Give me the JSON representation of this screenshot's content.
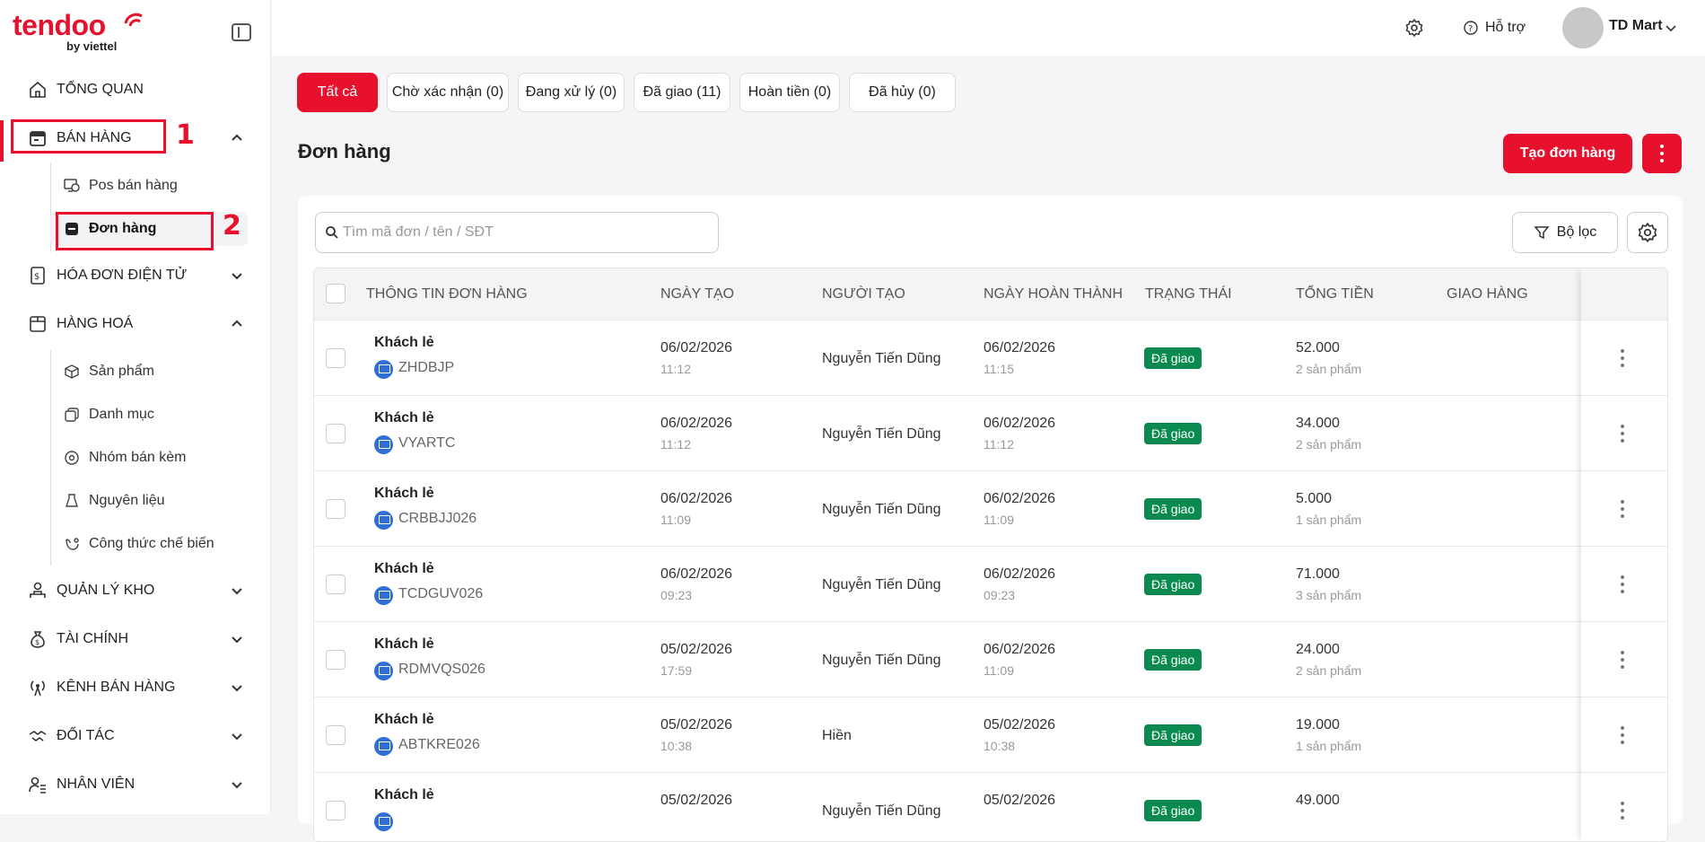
{
  "app": {
    "logo": "tendoo",
    "logo_sub": "by viettel"
  },
  "sidebar": {
    "items": [
      {
        "label": "TỔNG QUAN",
        "icon": "home-icon"
      },
      {
        "label": "BÁN HÀNG",
        "icon": "store-icon"
      },
      {
        "label": "HÓA ĐƠN ĐIỆN TỬ",
        "icon": "invoice-icon"
      },
      {
        "label": "HÀNG HOÁ",
        "icon": "box-icon"
      },
      {
        "label": "QUẢN LÝ KHO",
        "icon": "warehouse-icon"
      },
      {
        "label": "TÀI CHÍNH",
        "icon": "money-bag-icon"
      },
      {
        "label": "KÊNH BÁN HÀNG",
        "icon": "broadcast-icon"
      },
      {
        "label": "ĐỐI TÁC",
        "icon": "handshake-icon"
      },
      {
        "label": "NHÂN VIÊN",
        "icon": "staff-icon"
      }
    ],
    "sales_sub": [
      {
        "label": "Pos bán hàng",
        "icon": "pos-icon"
      },
      {
        "label": "Đơn hàng",
        "icon": "order-icon"
      }
    ],
    "goods_sub": [
      {
        "label": "Sản phẩm",
        "icon": "cube-icon"
      },
      {
        "label": "Danh mục",
        "icon": "category-icon"
      },
      {
        "label": "Nhóm bán kèm",
        "icon": "bundle-icon"
      },
      {
        "label": "Nguyên liệu",
        "icon": "ingredient-icon"
      },
      {
        "label": "Công thức chế biến",
        "icon": "recipe-icon"
      }
    ],
    "annotations": [
      "1",
      "2"
    ]
  },
  "header": {
    "support": "Hỗ trợ",
    "user": "TD Mart"
  },
  "tabs": [
    "Tất cả",
    "Chờ xác nhận (0)",
    "Đang xử lý (0)",
    "Đã giao (11)",
    "Hoàn tiền (0)",
    "Đã hủy (0)"
  ],
  "page": {
    "title": "Đơn hàng",
    "create_button": "Tạo đơn hàng"
  },
  "search": {
    "placeholder": "Tìm mã đơn / tên / SĐT"
  },
  "filter": {
    "label": "Bộ lọc"
  },
  "table": {
    "columns": [
      "THÔNG TIN ĐƠN HÀNG",
      "NGÀY TẠO",
      "NGƯỜI TẠO",
      "NGÀY HOÀN THÀNH",
      "TRẠNG THÁI",
      "TỔNG TIỀN",
      "GIAO HÀNG"
    ],
    "rows": [
      {
        "customer": "Khách lẻ",
        "code": "ZHDBJP",
        "created_date": "06/02/2026",
        "created_time": "11:12",
        "creator": "Nguyễn Tiến Dũng",
        "done_date": "06/02/2026",
        "done_time": "11:15",
        "status": "Đã giao",
        "total": "52.000",
        "qty": "2 sản phẩm"
      },
      {
        "customer": "Khách lẻ",
        "code": "VYARTC",
        "created_date": "06/02/2026",
        "created_time": "11:12",
        "creator": "Nguyễn Tiến Dũng",
        "done_date": "06/02/2026",
        "done_time": "11:12",
        "status": "Đã giao",
        "total": "34.000",
        "qty": "2 sản phẩm"
      },
      {
        "customer": "Khách lẻ",
        "code": "CRBBJJ026",
        "created_date": "06/02/2026",
        "created_time": "11:09",
        "creator": "Nguyễn Tiến Dũng",
        "done_date": "06/02/2026",
        "done_time": "11:09",
        "status": "Đã giao",
        "total": "5.000",
        "qty": "1 sản phẩm"
      },
      {
        "customer": "Khách lẻ",
        "code": "TCDGUV026",
        "created_date": "06/02/2026",
        "created_time": "09:23",
        "creator": "Nguyễn Tiến Dũng",
        "done_date": "06/02/2026",
        "done_time": "09:23",
        "status": "Đã giao",
        "total": "71.000",
        "qty": "3 sản phẩm"
      },
      {
        "customer": "Khách lẻ",
        "code": "RDMVQS026",
        "created_date": "05/02/2026",
        "created_time": "17:59",
        "creator": "Nguyễn Tiến Dũng",
        "done_date": "06/02/2026",
        "done_time": "11:09",
        "status": "Đã giao",
        "total": "24.000",
        "qty": "2 sản phẩm"
      },
      {
        "customer": "Khách lẻ",
        "code": "ABTKRE026",
        "created_date": "05/02/2026",
        "created_time": "10:38",
        "creator": "Hiền",
        "done_date": "05/02/2026",
        "done_time": "10:38",
        "status": "Đã giao",
        "total": "19.000",
        "qty": "1 sản phẩm"
      },
      {
        "customer": "Khách lẻ",
        "code": "",
        "created_date": "05/02/2026",
        "created_time": "",
        "creator": "Nguyễn Tiến Dũng",
        "done_date": "05/02/2026",
        "done_time": "",
        "status": "Đã giao",
        "total": "49.000",
        "qty": ""
      }
    ]
  },
  "colors": {
    "accent": "#e8112d",
    "success": "#0b8a4f"
  }
}
